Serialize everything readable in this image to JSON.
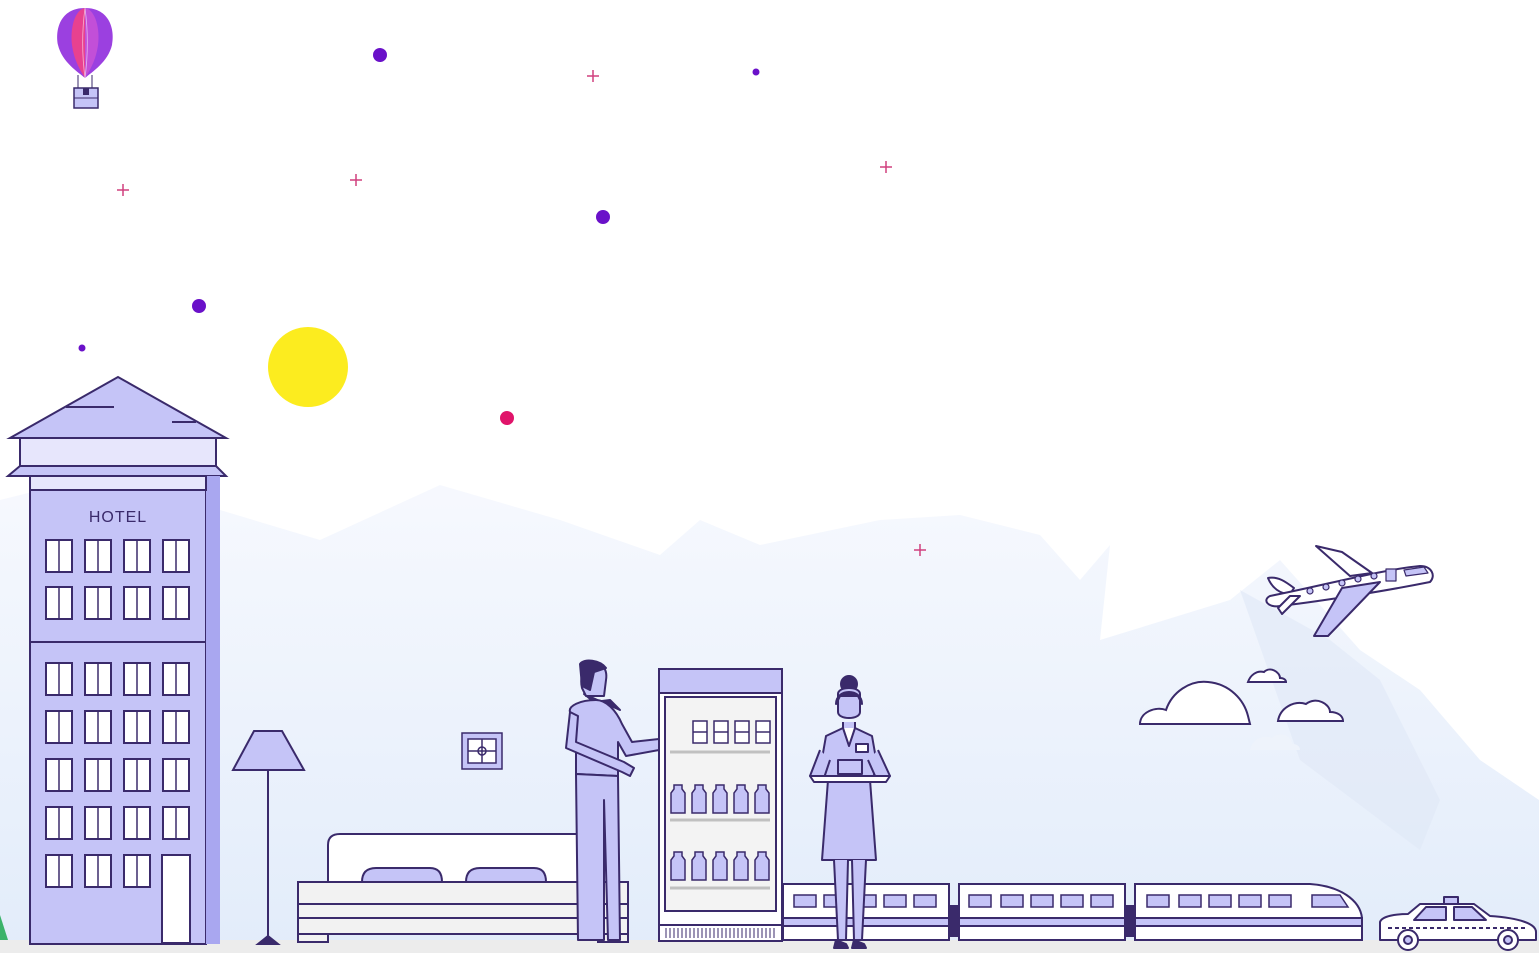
{
  "scene": {
    "hotel_sign": "HOTEL"
  },
  "colors": {
    "outline": "#3a2a6b",
    "lavender": "#c5c4f7",
    "lavender_light": "#e7e6fc",
    "sky_fill": "#eef3fb",
    "sun": "#fcec1f",
    "dot_purple": "#6a11c9",
    "dot_pink": "#e0146a",
    "plus_pink": "#d0407e",
    "balloon_pink": "#e8418f",
    "balloon_purple": "#9b40e0",
    "ground": "#ececec"
  },
  "icons": [
    "hot-air-balloon",
    "sun",
    "hotel-building",
    "floor-lamp",
    "wall-switch",
    "bed",
    "man",
    "vending-fridge",
    "flight-attendant",
    "train",
    "airplane",
    "cloud",
    "taxi"
  ]
}
